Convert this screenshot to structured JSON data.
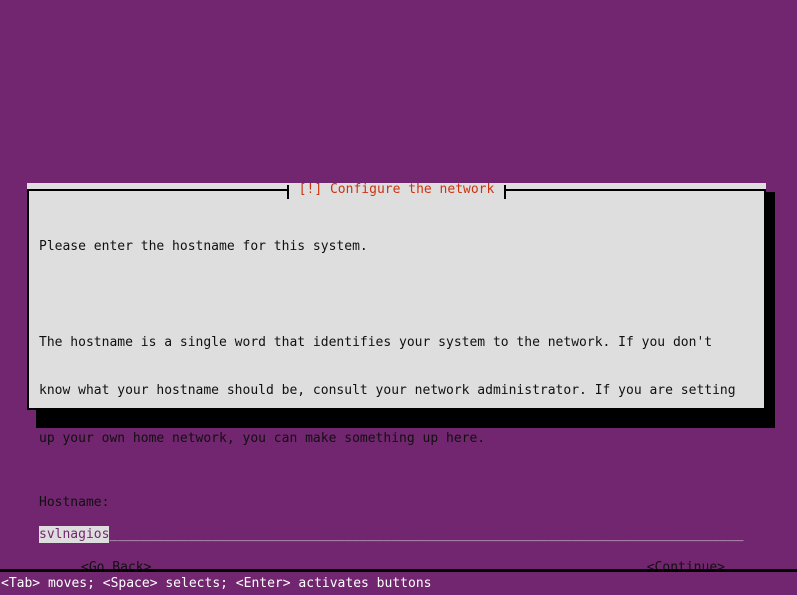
{
  "screen": {
    "background_color": "#72266f",
    "foreground_color": "#dedede"
  },
  "dialog": {
    "title": "[!] Configure the network",
    "title_color": "#cc3311",
    "background_color": "#dedede",
    "border_color": "#000000",
    "paragraphs": [
      {
        "lines": [
          "Please enter the hostname for this system."
        ]
      },
      {
        "lines": [
          "The hostname is a single word that identifies your system to the network. If you don't",
          "know what your hostname should be, consult your network administrator. If you are setting",
          "up your own home network, you can make something up here."
        ]
      }
    ],
    "field": {
      "label": "Hostname:",
      "value": "svlnagios",
      "cursor": "_",
      "fill": "________________________________________________________________________________",
      "selected": true,
      "field_background_color": "#72266f",
      "selection_background_color": "#dedede",
      "selection_text_color": "#72266f"
    },
    "buttons": {
      "go_back": "<Go Back>",
      "continue": "<Continue>"
    }
  },
  "status_bar": {
    "text": "<Tab> moves; <Space> selects; <Enter> activates buttons",
    "background_color": "#72266f",
    "text_color": "#ffffff"
  }
}
